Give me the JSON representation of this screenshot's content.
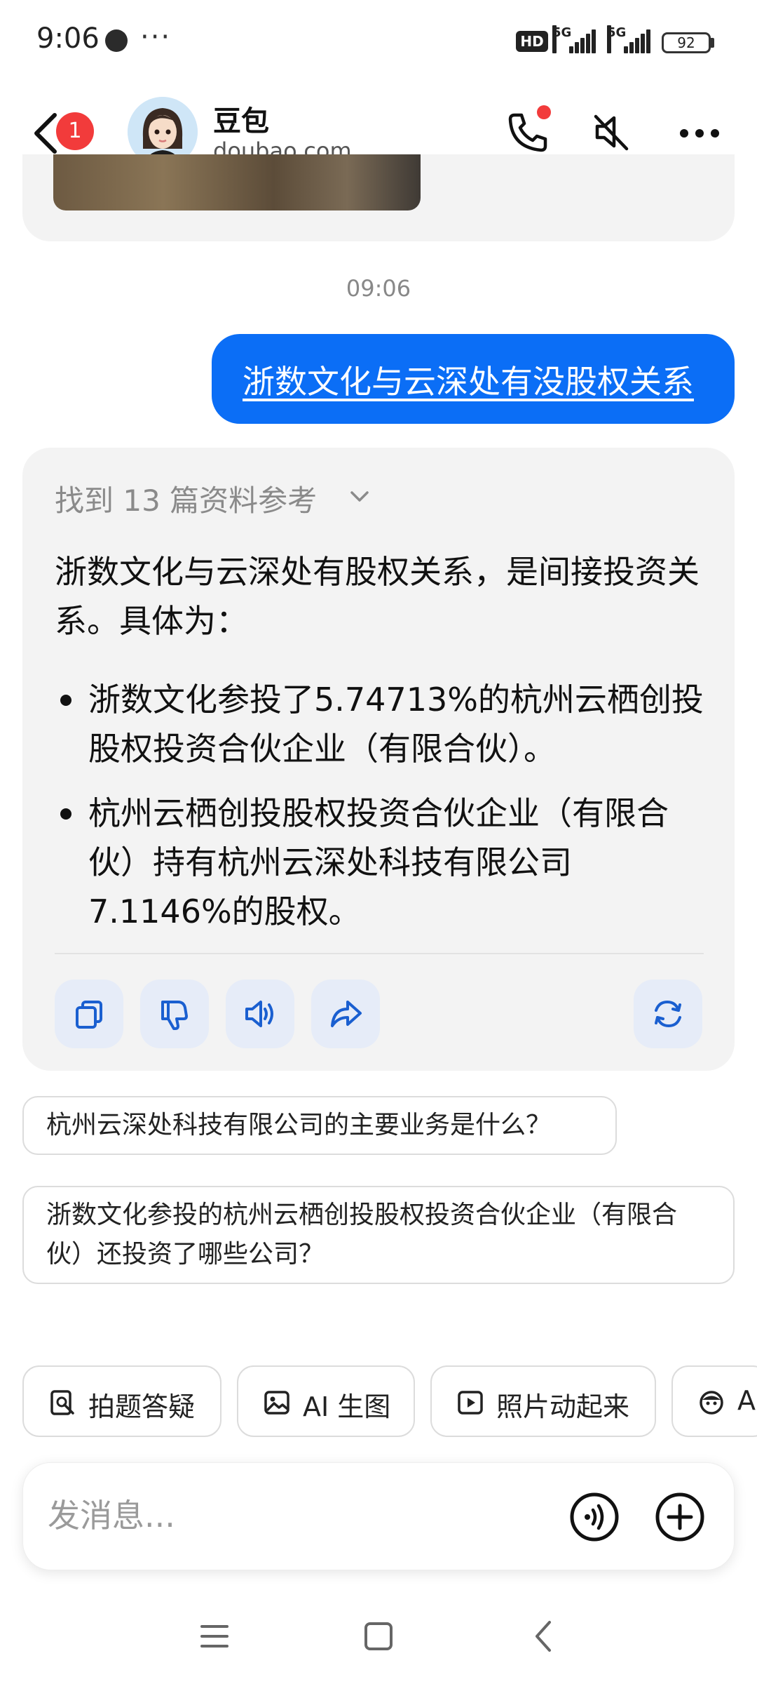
{
  "status_bar": {
    "time": "9:06",
    "more": "···",
    "hd": "HD",
    "network_1": "5G",
    "network_2": "5G",
    "battery": "92"
  },
  "header": {
    "unread_count": "1",
    "name": "豆包",
    "domain": "doubao.com"
  },
  "chat": {
    "timestamp": "09:06",
    "user_message": "浙数文化与云深处有没股权关系",
    "answer": {
      "references": "找到 13 篇资料参考",
      "intro": "浙数文化与云深处有股权关系，是间接投资关系。具体为：",
      "bullets": [
        "浙数文化参投了5.74713%的杭州云栖创投股权投资合伙企业（有限合伙）。",
        "杭州云栖创投股权投资合伙企业（有限合伙）持有杭州云深处科技有限公司7.1146%的股权。"
      ]
    }
  },
  "suggestions": [
    "杭州云深处科技有限公司的主要业务是什么？",
    "浙数文化参投的杭州云栖创投股权投资合伙企业（有限合伙）还投资了哪些公司？"
  ],
  "tools": [
    {
      "label": "拍题答疑",
      "icon": "photo-question-icon"
    },
    {
      "label": "AI 生图",
      "icon": "image-icon"
    },
    {
      "label": "照片动起来",
      "icon": "play-icon"
    },
    {
      "label": "A",
      "icon": "face-icon"
    }
  ],
  "input": {
    "placeholder": "发消息..."
  },
  "colors": {
    "accent": "#0b6ef6",
    "bubble_bg": "#f3f3f3",
    "badge": "#f23b3b"
  }
}
